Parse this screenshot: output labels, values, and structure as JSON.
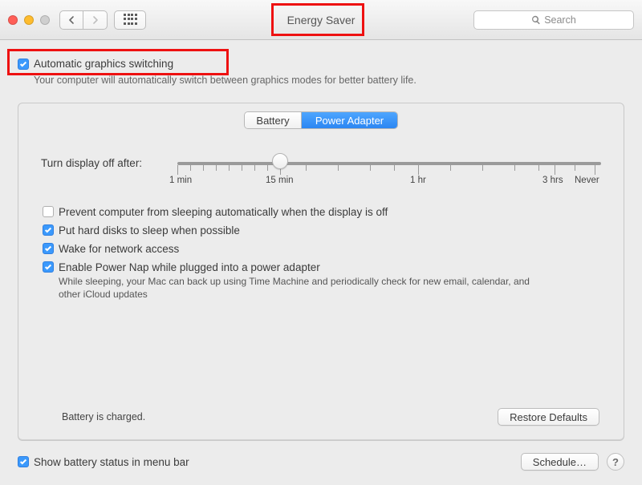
{
  "window": {
    "title": "Energy Saver"
  },
  "search": {
    "placeholder": "Search"
  },
  "auto_graphics": {
    "label": "Automatic graphics switching",
    "subtitle": "Your computer will automatically switch between graphics modes for better battery life."
  },
  "tabs": {
    "battery": "Battery",
    "power_adapter": "Power Adapter"
  },
  "slider": {
    "label": "Turn display off after:",
    "ticks": {
      "t0": "1 min",
      "t1": "15 min",
      "t2": "1 hr",
      "t3": "3 hrs",
      "t4": "Never"
    }
  },
  "options": {
    "prevent_sleep": "Prevent computer from sleeping automatically when the display is off",
    "hd_sleep": "Put hard disks to sleep when possible",
    "wake_network": "Wake for network access",
    "power_nap": "Enable Power Nap while plugged into a power adapter",
    "power_nap_sub": "While sleeping, your Mac can back up using Time Machine and periodically check for new email, calendar, and other iCloud updates"
  },
  "status": {
    "battery": "Battery is charged."
  },
  "buttons": {
    "restore_defaults": "Restore Defaults",
    "schedule": "Schedule…"
  },
  "menubar_option": "Show battery status in menu bar"
}
